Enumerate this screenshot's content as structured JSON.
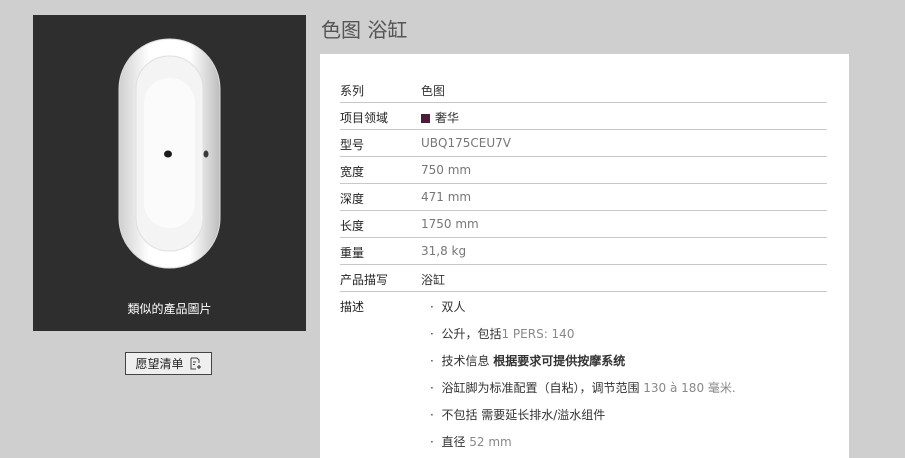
{
  "page_title": "色图 浴缸",
  "image_caption": "類似的產品圖片",
  "wishlist_button": "愿望清单",
  "specs": [
    {
      "key": "系列",
      "value": "色图"
    },
    {
      "key": "项目领域",
      "value": "奢华"
    },
    {
      "key": "型号",
      "value": "UBQ175CEU7V"
    },
    {
      "key": "宽度",
      "value": "750 mm"
    },
    {
      "key": "深度",
      "value": "471 mm"
    },
    {
      "key": "长度",
      "value": "1750 mm"
    },
    {
      "key": "重量",
      "value": "31,8 kg"
    },
    {
      "key": "产品描写",
      "value": "浴缸"
    }
  ],
  "description_label": "描述",
  "bullets": [
    {
      "a": "双人",
      "b": "",
      "c": ""
    },
    {
      "a": "公升，包括",
      "b": "1 PERS: 140",
      "c": ""
    },
    {
      "a": "技术信息 ",
      "strong": "根据要求可提供按摩系统"
    },
    {
      "a": "浴缸脚为标准配置（自粘），调节范围 ",
      "b": "130 à 180",
      "c": " 毫米."
    },
    {
      "a": "不包括 需要延长排水/溢水组件",
      "b": "",
      "c": ""
    },
    {
      "a": "直径 ",
      "b": "52 mm",
      "c": ""
    }
  ],
  "colors": {
    "category_swatch": "#4b1d3a"
  }
}
